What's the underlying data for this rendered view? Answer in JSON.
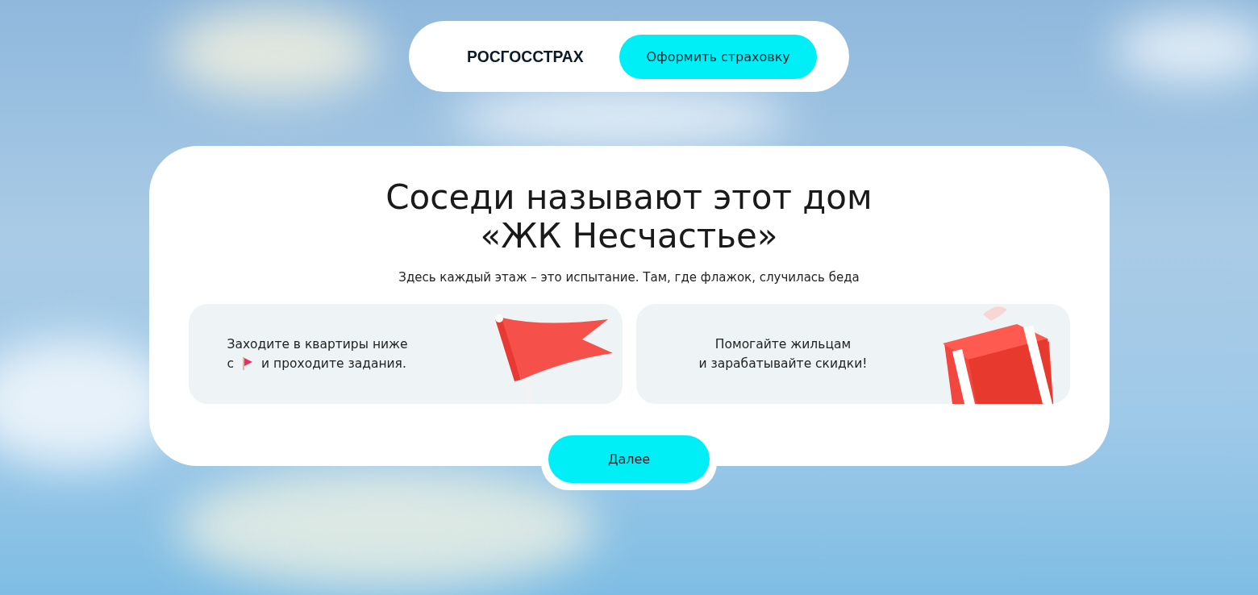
{
  "header": {
    "logo": "РОСГОССТРАХ",
    "button": "Оформить страховку"
  },
  "main": {
    "title_lines": [
      "Соседи называют этот дом",
      "«ЖК Несчастье»"
    ],
    "subtitle": "Здесь каждый этаж – это испытание. Там, где флажок, случилась беда",
    "cards": [
      {
        "kind": "flag",
        "lines": [
          [
            "Заходите в квартиры ниже"
          ],
          [
            "с",
            "и проходите задания."
          ]
        ]
      },
      {
        "kind": "gift",
        "lines": [
          [
            "Помогайте жильцам"
          ],
          [
            "и зарабатывайте скидки!"
          ]
        ]
      }
    ],
    "button": "Далее"
  }
}
